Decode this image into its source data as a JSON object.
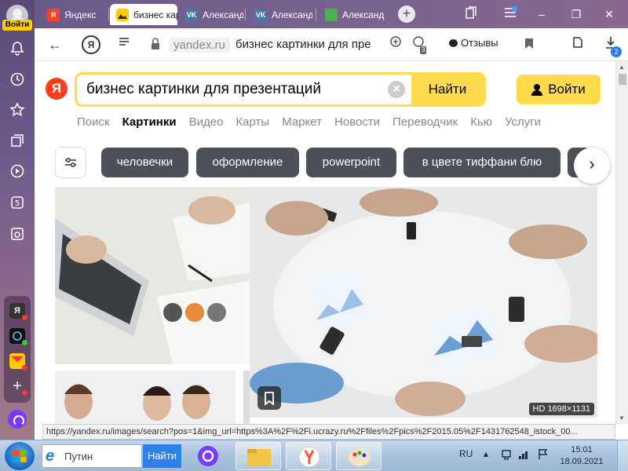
{
  "sidebar": {
    "login_label": "Войти",
    "apps": [
      {
        "icon": "yandex-app-icon",
        "label": "Я"
      }
    ]
  },
  "tabs": [
    {
      "label": "Яндекс",
      "icon": "yandex-icon",
      "color": "#fc3f1d"
    },
    {
      "label": "бизнес картинки для презентаций",
      "icon": "images-icon",
      "color": "#ffcc00",
      "active": true
    },
    {
      "label": "Александр",
      "icon": "vk-icon",
      "color": "#4c75a3"
    },
    {
      "label": "Александр",
      "icon": "vk-icon",
      "color": "#4c75a3"
    },
    {
      "label": "Александр",
      "icon": "green-square-icon",
      "color": "#4caf50"
    }
  ],
  "address_bar": {
    "domain": "yandex.ru",
    "page_title": "бизнес картинки для презентаций",
    "reviews_label": "Отзывы",
    "shield_count": "3",
    "downloads_count": "2"
  },
  "search": {
    "query": "бизнес картинки для презентаций",
    "button_label": "Найти",
    "logo_letter": "Я"
  },
  "login_button": "Войти",
  "services": [
    {
      "label": "Поиск"
    },
    {
      "label": "Картинки",
      "active": true
    },
    {
      "label": "Видео"
    },
    {
      "label": "Карты"
    },
    {
      "label": "Маркет"
    },
    {
      "label": "Новости"
    },
    {
      "label": "Переводчик"
    },
    {
      "label": "Кью"
    },
    {
      "label": "Услуги"
    }
  ],
  "chips": [
    "человечки",
    "оформление",
    "powerpoint",
    "в цвете тиффани блю"
  ],
  "results": {
    "main_image_badge": "HD 1698×1131"
  },
  "status_url": "https://yandex.ru/images/search?pos=1&img_url=https%3A%2F%2Fi.ucrazy.ru%2Ffiles%2Fpics%2F2015.05%2F1431762548_istock_00...",
  "taskbar": {
    "search_placeholder": "Путин",
    "search_button": "Найти",
    "language": "RU",
    "time": "15:01",
    "date": "18.09.2021"
  }
}
